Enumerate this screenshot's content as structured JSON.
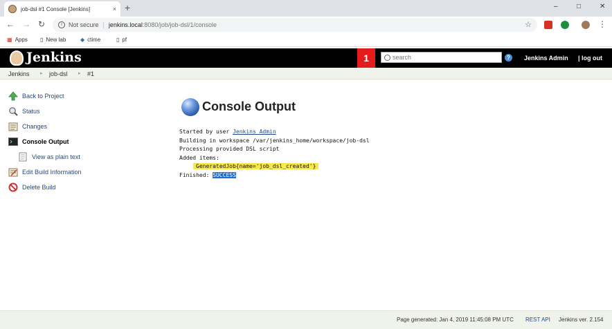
{
  "browser": {
    "tab_title": "job-dsl #1 Console [Jenkins]",
    "tab_close": "×",
    "new_tab": "+",
    "window_controls": [
      "–",
      "□",
      "✕"
    ],
    "nav": {
      "back": "←",
      "forward": "→",
      "reload": "↻"
    },
    "omnibox": {
      "security_label": "Not secure",
      "host": "jenkins.local",
      "path": ":8080/job/job-dsl/1/console",
      "star": "☆"
    },
    "bookmarks": [
      {
        "label": "Apps",
        "icon": "apps-grid-icon"
      },
      {
        "label": "New lab",
        "icon": "page-icon"
      },
      {
        "label": "ctime",
        "icon": "python-icon"
      },
      {
        "label": "pf",
        "icon": "page-icon"
      }
    ],
    "menu_glyph": "⋮"
  },
  "header": {
    "logo_text": "Jenkins",
    "notification_count": "1",
    "search_placeholder": "search",
    "help_glyph": "?",
    "user_name": "Jenkins Admin",
    "logout_label": "| log out"
  },
  "breadcrumb": [
    "Jenkins",
    "job-dsl",
    "#1"
  ],
  "breadcrumb_sep": "▸",
  "sidebar": {
    "items": [
      {
        "label": "Back to Project",
        "icon": "up-arrow-icon"
      },
      {
        "label": "Status",
        "icon": "magnifier-icon"
      },
      {
        "label": "Changes",
        "icon": "notepad-icon"
      },
      {
        "label": "Console Output",
        "icon": "terminal-icon"
      },
      {
        "label": "View as plain text",
        "icon": "document-icon"
      },
      {
        "label": "Edit Build Information",
        "icon": "notepad-edit-icon"
      },
      {
        "label": "Delete Build",
        "icon": "no-entry-icon"
      }
    ]
  },
  "main": {
    "title": "Console Output",
    "console": {
      "line1_prefix": "Started by user ",
      "line1_user": "Jenkins Admin",
      "line2": "Building in workspace /var/jenkins_home/workspace/job-dsl",
      "line3": "Processing provided DSL script",
      "line4": "Added items:",
      "line5": "GeneratedJob{name='job_dsl_created'}",
      "line6_prefix": "Finished: ",
      "line6_status": "SUCCESS"
    }
  },
  "footer": {
    "generated": "Page generated: Jan 4, 2019 11:45:08 PM UTC",
    "rest_api": "REST API",
    "version": "Jenkins ver. 2.154"
  },
  "colors": {
    "header_bg": "#000000",
    "badge_red": "#e41c1c",
    "link_blue": "#204a87",
    "highlight_yellow": "#f7e84a",
    "success_blue": "#1f6fd0"
  }
}
